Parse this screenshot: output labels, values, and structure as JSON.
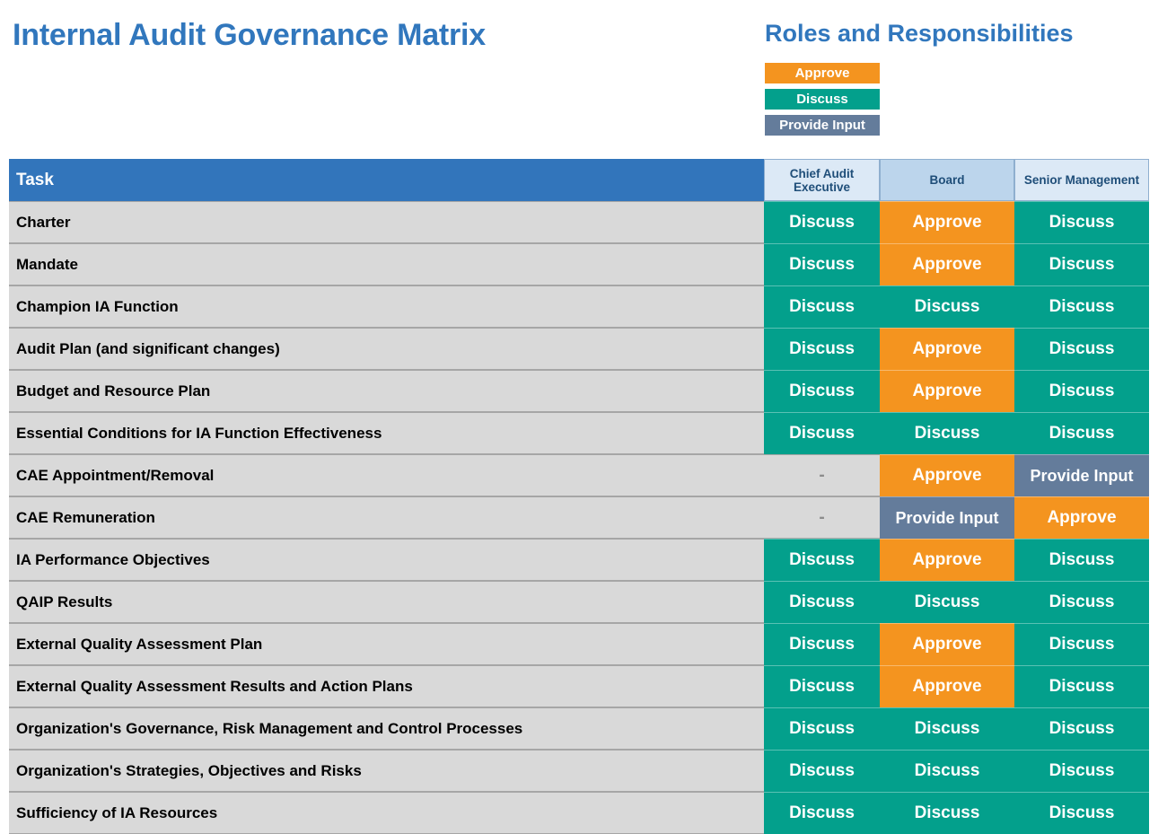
{
  "page": {
    "title": "Internal Audit Governance Matrix",
    "legend_title": "Roles and Responsibilities"
  },
  "legend": {
    "items": [
      {
        "label": "Approve",
        "color": "#F4941F",
        "key": "approve"
      },
      {
        "label": "Discuss",
        "color": "#03A08C",
        "key": "discuss"
      },
      {
        "label": "Provide Input",
        "color": "#647C9B",
        "key": "input"
      }
    ]
  },
  "colors": {
    "title_blue": "#3177BD",
    "header_blue": "#3275BB",
    "role_header_bg": "#DCE9F6",
    "role_header_bg_board": "#BCD5EC",
    "role_header_text": "#1F4E79",
    "task_bg": "#D9D9D9",
    "approve": "#F4941F",
    "discuss": "#03A08C",
    "provide_input": "#647C9B",
    "none_text": "#8C8C8C"
  },
  "table": {
    "headers": {
      "task": "Task",
      "roles": [
        "Chief Audit Executive",
        "Board",
        "Senior Management"
      ]
    },
    "none_label": "-",
    "rows": [
      {
        "task": "Charter",
        "values": [
          "Discuss",
          "Approve",
          "Discuss"
        ]
      },
      {
        "task": "Mandate",
        "values": [
          "Discuss",
          "Approve",
          "Discuss"
        ]
      },
      {
        "task": "Champion IA Function",
        "values": [
          "Discuss",
          "Discuss",
          "Discuss"
        ]
      },
      {
        "task": "Audit Plan (and significant changes)",
        "values": [
          "Discuss",
          "Approve",
          "Discuss"
        ]
      },
      {
        "task": "Budget and Resource Plan",
        "values": [
          "Discuss",
          "Approve",
          "Discuss"
        ]
      },
      {
        "task": "Essential Conditions for IA Function Effectiveness",
        "values": [
          "Discuss",
          "Discuss",
          "Discuss"
        ]
      },
      {
        "task": "CAE Appointment/Removal",
        "values": [
          "-",
          "Approve",
          "Provide Input"
        ]
      },
      {
        "task": "CAE Remuneration",
        "values": [
          "-",
          "Provide Input",
          "Approve"
        ]
      },
      {
        "task": "IA Performance Objectives",
        "values": [
          "Discuss",
          "Approve",
          "Discuss"
        ]
      },
      {
        "task": "QAIP Results",
        "values": [
          "Discuss",
          "Discuss",
          "Discuss"
        ]
      },
      {
        "task": "External Quality Assessment Plan",
        "values": [
          "Discuss",
          "Approve",
          "Discuss"
        ]
      },
      {
        "task": "External Quality Assessment Results and Action Plans",
        "values": [
          "Discuss",
          "Approve",
          "Discuss"
        ]
      },
      {
        "task": "Organization's Governance, Risk Management and Control Processes",
        "values": [
          "Discuss",
          "Discuss",
          "Discuss"
        ]
      },
      {
        "task": "Organization's Strategies, Objectives and Risks",
        "values": [
          "Discuss",
          "Discuss",
          "Discuss"
        ]
      },
      {
        "task": "Sufficiency of IA Resources",
        "values": [
          "Discuss",
          "Discuss",
          "Discuss"
        ]
      }
    ]
  }
}
